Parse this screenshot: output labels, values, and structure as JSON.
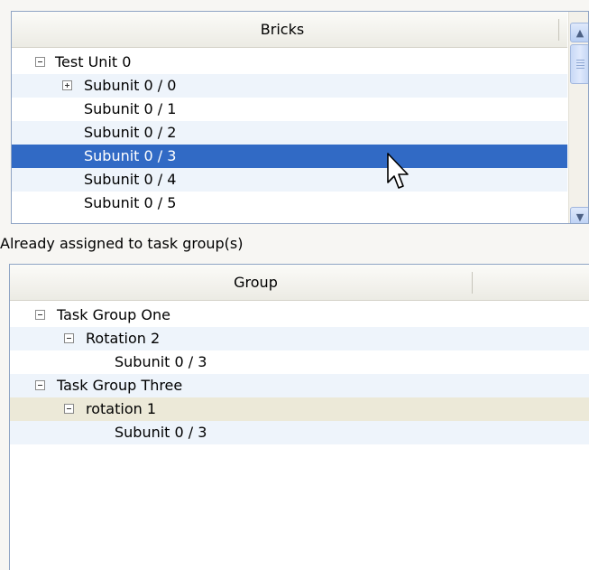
{
  "bricks": {
    "header": "Bricks",
    "rows": [
      {
        "label": "Test Unit 0",
        "expander": "minus"
      },
      {
        "label": "Subunit 0 / 0",
        "expander": "plus"
      },
      {
        "label": "Subunit 0 / 1"
      },
      {
        "label": "Subunit 0 / 2"
      },
      {
        "label": "Subunit 0 / 3",
        "selected": true
      },
      {
        "label": "Subunit 0 / 4"
      },
      {
        "label": "Subunit 0 / 5"
      }
    ],
    "scroll_up_icon": "▲",
    "scroll_down_icon": "▼"
  },
  "assigned_label": "Already assigned to task group(s)",
  "groups": {
    "header": "Group",
    "rows": [
      {
        "label": "Task Group One",
        "expander": "minus"
      },
      {
        "label": "Rotation 2",
        "expander": "minus"
      },
      {
        "label": "Subunit 0 / 3"
      },
      {
        "label": "Task Group Three",
        "expander": "minus"
      },
      {
        "label": "rotation 1",
        "expander": "minus"
      },
      {
        "label": "Subunit 0 / 3"
      }
    ]
  },
  "colors": {
    "selection": "#316ac5",
    "alt_row": "#eef4fb",
    "highlight_row": "#ece9d8",
    "border": "#8fa4c4"
  }
}
